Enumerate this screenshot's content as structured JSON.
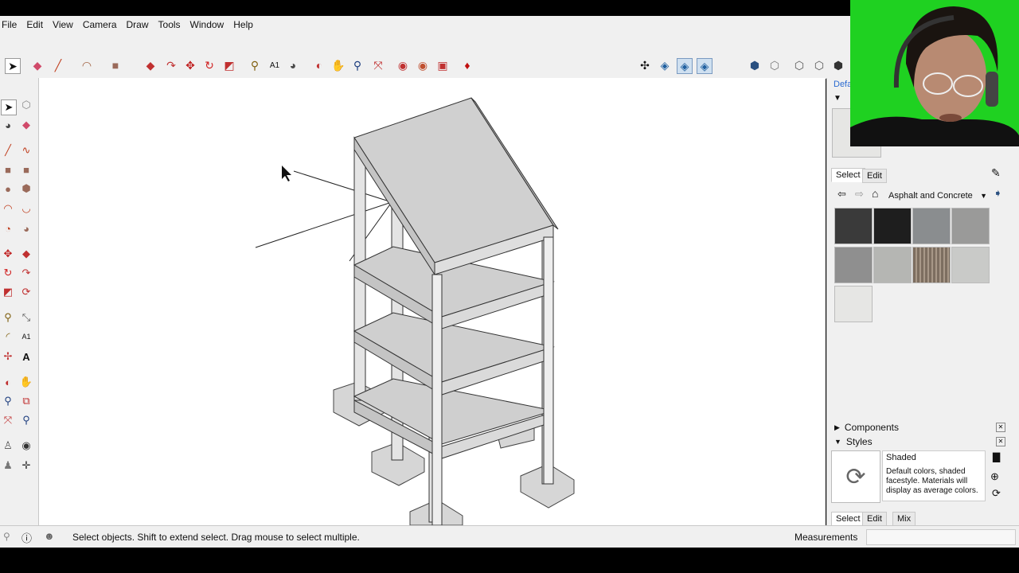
{
  "menu": [
    "File",
    "Edit",
    "View",
    "Camera",
    "Draw",
    "Tools",
    "Window",
    "Help"
  ],
  "status": {
    "hint": "Select objects. Shift to extend select. Drag mouse to select multiple.",
    "measurements_label": "Measurements",
    "measurements_value": ""
  },
  "materials": {
    "header_partial": "Defa",
    "tabs": [
      "Select",
      "Edit"
    ],
    "collection": "Asphalt and Concrete",
    "swatch_colors": [
      "#3a3a3a",
      "#1e1e1e",
      "#8a8d8f",
      "#9a9a99",
      "#8f8f8f",
      "#b5b6b3",
      "#7d6e60",
      "#c9cac8",
      "#e6e6e4"
    ]
  },
  "components": {
    "label": "Components"
  },
  "styles": {
    "label": "Styles",
    "name": "Shaded",
    "description": "Default colors, shaded facestyle. Materials will display as average colors.",
    "tabs": [
      "Select",
      "Edit",
      "Mix"
    ]
  },
  "colors": {
    "accent": "#1a5fb4",
    "chrome": "#f0f0f0",
    "webcam_bg": "#1fd121"
  }
}
